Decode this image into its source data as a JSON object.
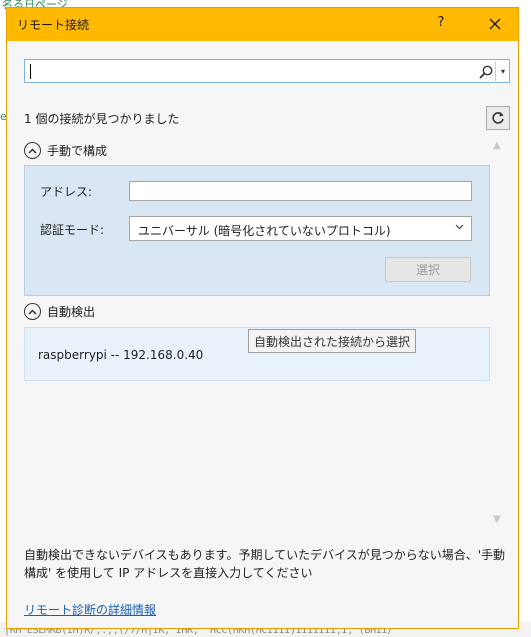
{
  "background": {
    "top_text": "名る日ページ",
    "left_text": "e",
    "bottom_text": "|RH*ESEMRB(IH)R/,.,,(/7/H|IK, IHR, ^HCC(HKH(HCIIII)IIIIIII,I, (BHII/"
  },
  "dialog": {
    "title": "リモート接続",
    "help_label": "?",
    "close_icon": "close-icon"
  },
  "search": {
    "value": "",
    "placeholder": "",
    "icon": "search-icon",
    "dropdown_glyph": "▾"
  },
  "status": {
    "found_text": "1 個の接続が見つかりました",
    "refresh_icon": "refresh-icon"
  },
  "manual": {
    "header": "手動で構成",
    "address_label": "アドレス:",
    "address_value": "",
    "auth_label": "認証モード:",
    "auth_value": "ユニバーサル (暗号化されていないプロトコル)",
    "select_button": "選択"
  },
  "auto": {
    "header": "自動検出",
    "devices": [
      {
        "name": "raspberrypi -- 192.168.0.40"
      }
    ],
    "tooltip": "自動検出された接続から選択"
  },
  "footer": {
    "note_line1": "自動検出できないデバイスもあります。予期していたデバイスが見つからない場合、'手動",
    "note_line2": "構成' を使用して IP アドレスを直接入力してください",
    "link": "リモート診断の詳細情報"
  },
  "colors": {
    "titlebar": "#ffb900",
    "panel": "#d9e7f4",
    "link": "#1a5fb4"
  }
}
